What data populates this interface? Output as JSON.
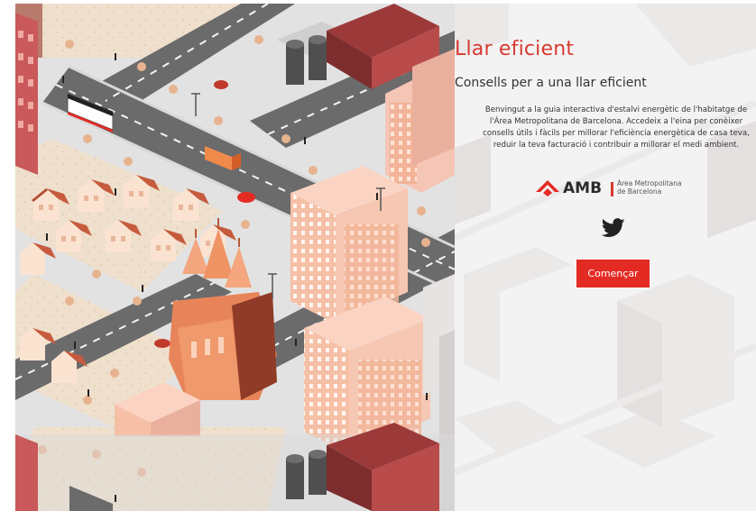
{
  "colors": {
    "accent": "#e32b24",
    "title": "#d73a2f",
    "text": "#333333",
    "panel_bg": "#f4f3f3"
  },
  "illustration": {
    "icon": "city-illustration"
  },
  "panel": {
    "title": "Llar eficient",
    "subtitle": "Consells per a una llar eficient",
    "intro": "Benvingut a la guia interactiva d'estalvi energètic de l'habitatge de l'Àrea Metropolitana de Barcelona. Accedeix a l'eina per conèixer consells útils i fàcils per millorar l'eficiència energètica de casa teva, reduir la teva facturació i contribuir a millorar el medi ambient.",
    "logo": {
      "icon": "amb-logo-icon",
      "abbr": "AMB",
      "line1": "Àrea Metropolitana",
      "line2": "de Barcelona"
    },
    "twitter_icon": "twitter-icon",
    "start_label": "Començar"
  }
}
